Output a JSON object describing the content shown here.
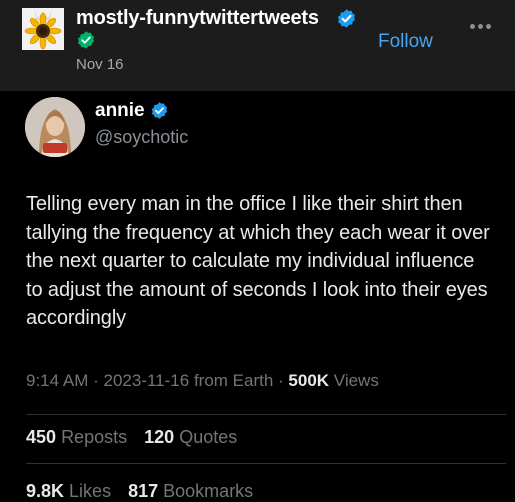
{
  "post": {
    "blog_name": "mostly-funnytwittertweets",
    "date": "Nov 16",
    "follow_label": "Follow",
    "more_label": "•••"
  },
  "tweet": {
    "display_name": "annie",
    "handle": "@soychotic",
    "text": "Telling every man in the office I like their shirt then tallying the frequency at which they each wear it over the next quarter to calculate my individual influence to adjust the amount of seconds I look into their eyes accordingly",
    "time": "9:14 AM",
    "date": "2023-11-16",
    "source": "from Earth",
    "views_count": "500K",
    "views_label": "Views",
    "reposts_count": "450",
    "reposts_label": "Reposts",
    "quotes_count": "120",
    "quotes_label": "Quotes",
    "likes_count": "9.8K",
    "likes_label": "Likes",
    "bookmarks_count": "817",
    "bookmarks_label": "Bookmarks"
  },
  "colors": {
    "header_bg": "#1c1c1c",
    "follow": "#4aa3ee",
    "verified_blue": "#1d9bf0",
    "verified_green": "#00b06b"
  }
}
